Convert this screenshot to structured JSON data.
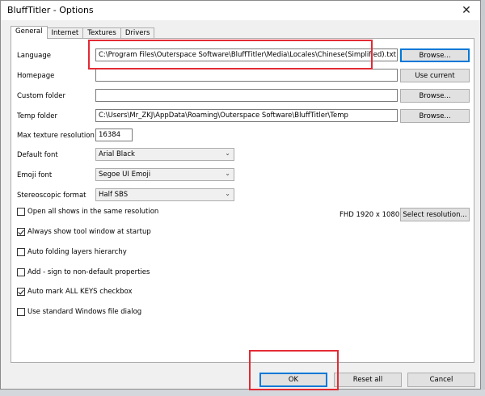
{
  "window": {
    "title": "BluffTitler - Options",
    "close_glyph": "✕"
  },
  "tabs": [
    {
      "label": "General",
      "active": true
    },
    {
      "label": "Internet",
      "active": false
    },
    {
      "label": "Textures",
      "active": false
    },
    {
      "label": "Drivers",
      "active": false
    }
  ],
  "fields": {
    "language": {
      "label": "Language",
      "value": "C:\\Program Files\\Outerspace Software\\BluffTitler\\Media\\Locales\\Chinese(Simplified).txt",
      "button": "Browse..."
    },
    "homepage": {
      "label": "Homepage",
      "value": "",
      "button": "Use current"
    },
    "custom_folder": {
      "label": "Custom folder",
      "value": "",
      "button": "Browse..."
    },
    "temp_folder": {
      "label": "Temp folder",
      "value": "C:\\Users\\Mr_ZKJ\\AppData\\Roaming\\Outerspace Software\\BluffTitler\\Temp",
      "button": "Browse..."
    },
    "max_texture": {
      "label": "Max texture resolution",
      "value": "16384"
    }
  },
  "selects": {
    "default_font": {
      "label": "Default font",
      "value": "Arial Black"
    },
    "emoji_font": {
      "label": "Emoji font",
      "value": "Segoe UI Emoji"
    },
    "stereoscopic": {
      "label": "Stereoscopic format",
      "value": "Half SBS"
    }
  },
  "checkboxes": [
    {
      "label": "Open all shows in the same resolution",
      "checked": false
    },
    {
      "label": "Always show tool window at startup",
      "checked": true
    },
    {
      "label": "Auto folding layers hierarchy",
      "checked": false
    },
    {
      "label": "Add - sign to non-default properties",
      "checked": false
    },
    {
      "label": "Auto mark ALL KEYS checkbox",
      "checked": true
    },
    {
      "label": "Use standard Windows file dialog",
      "checked": false
    }
  ],
  "resolution": {
    "current": "FHD 1920 x 1080",
    "button": "Select resolution..."
  },
  "footer": {
    "ok": "OK",
    "reset": "Reset all",
    "cancel": "Cancel"
  },
  "colors": {
    "highlight": "#e32a34",
    "focus": "#0078d7"
  },
  "icons": {
    "select_arrow": "⌄"
  }
}
